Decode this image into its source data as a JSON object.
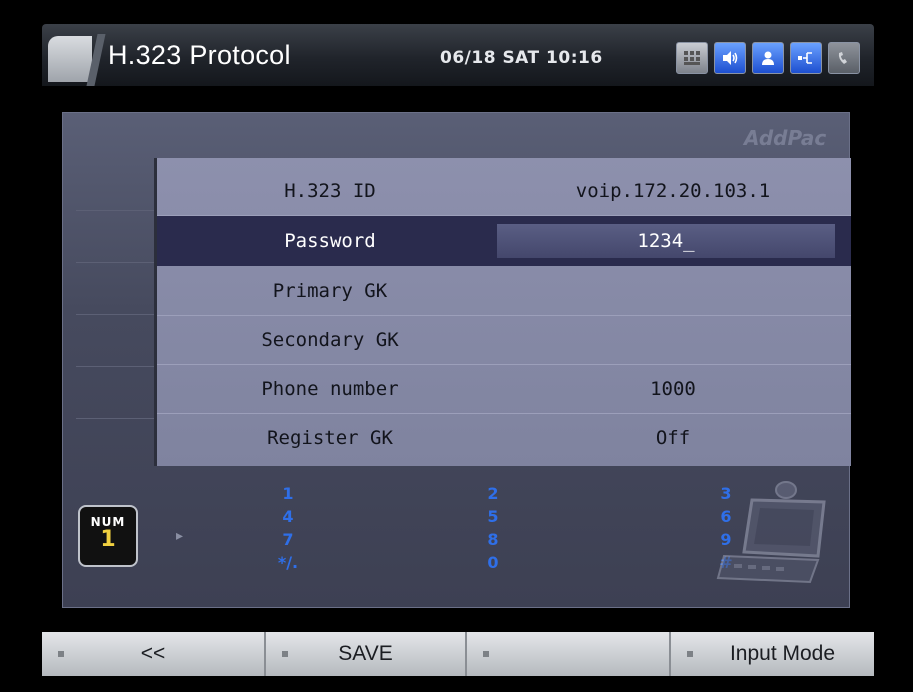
{
  "header": {
    "title": "H.323 Protocol",
    "datetime": "06/18 SAT 10:16",
    "status_icons": [
      "menu-grid-icon",
      "speaker-icon",
      "person-icon",
      "network-icon",
      "handset-icon"
    ]
  },
  "brand": "AddPac",
  "settings": {
    "rows": [
      {
        "label": "H.323 ID",
        "value": "voip.172.20.103.1"
      },
      {
        "label": "Password",
        "value": "1234_"
      },
      {
        "label": "Primary GK",
        "value": ""
      },
      {
        "label": "Secondary GK",
        "value": ""
      },
      {
        "label": "Phone number",
        "value": "1000"
      },
      {
        "label": "Register GK",
        "value": "Off"
      }
    ],
    "selected_row": "Password"
  },
  "input_mode": {
    "badge_label": "NUM",
    "badge_number": "1",
    "keys": [
      [
        "1",
        "4",
        "7",
        "*/."
      ],
      [
        "2",
        "5",
        "8",
        "0"
      ],
      [
        "3",
        "6",
        "9",
        "#"
      ]
    ]
  },
  "softkeys": [
    {
      "label": "<<"
    },
    {
      "label": "SAVE"
    },
    {
      "label": ""
    },
    {
      "label": "Input Mode"
    }
  ],
  "colors": {
    "selected_row_bg": "#2a2b4d",
    "list_bg": "#8d90ad",
    "keypad_digits": "#2f6fe8",
    "num_badge_digit": "#f0d040"
  }
}
